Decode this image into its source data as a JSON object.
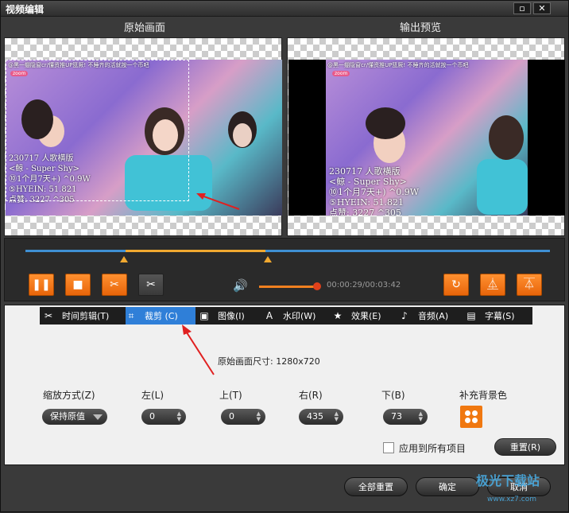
{
  "window": {
    "title": "视频编辑",
    "restore_glyph": "▫",
    "close_glyph": "✕"
  },
  "preview": {
    "original_label": "原始画面",
    "output_label": "输出预览",
    "video_top_text": "@黑一绷隐窗cr/懂资推UP篮厥! 不睡齐的活就按一个币吧",
    "video_badge": "zoom",
    "caption_lines": [
      "230717 人歌横版",
      "<鲸 - Super Shy>",
      "⑩1个月7天+) ^0.9W",
      "⑤HYEIN: 51.821",
      "点赞: 3227 ^305"
    ]
  },
  "timeline": {
    "time_display": "00:00:29/00:03:42",
    "buttons": {
      "pause_icon": "pause-icon",
      "stop_icon": "stop-icon",
      "cut_icon": "scissors-icon",
      "split_icon": "split-icon",
      "rotate_icon": "rotate-icon",
      "flip_h_icon": "flip-horizontal-icon",
      "flip_v_icon": "flip-vertical-icon",
      "volume_icon": "speaker-icon"
    },
    "volume_level": 0.9
  },
  "tabs": [
    {
      "label": "时间剪辑(T)",
      "icon": "scissors-icon"
    },
    {
      "label": "裁剪 (C)",
      "icon": "crop-icon",
      "active": true
    },
    {
      "label": "图像(I)",
      "icon": "image-icon"
    },
    {
      "label": "水印(W)",
      "icon": "watermark-icon"
    },
    {
      "label": "效果(E)",
      "icon": "star-icon"
    },
    {
      "label": "音频(A)",
      "icon": "music-note-icon"
    },
    {
      "label": "字幕(S)",
      "icon": "subtitle-icon"
    }
  ],
  "crop": {
    "original_size_label": "原始画面尺寸: 1280x720",
    "zoom_mode_label": "缩放方式(Z)",
    "zoom_mode_value": "保持原值",
    "left_label": "左(L)",
    "left_value": "0",
    "top_label": "上(T)",
    "top_value": "0",
    "right_label": "右(R)",
    "right_value": "435",
    "bottom_label": "下(B)",
    "bottom_value": "73",
    "bg_color_label": "补充背景色",
    "apply_all_label": "应用到所有项目",
    "reset_label": "重置(R)"
  },
  "footer": {
    "reset_all_label": "全部重置",
    "ok_label": "确定",
    "cancel_label": "取消"
  },
  "watermark": {
    "text": "极光下载站",
    "url": "www.xz7.com"
  },
  "colors": {
    "accent": "#f07810",
    "tab_active": "#2f7fd8",
    "track": "#3f8fd3",
    "selection": "#f0a830",
    "annotation_arrow": "#e02020"
  }
}
